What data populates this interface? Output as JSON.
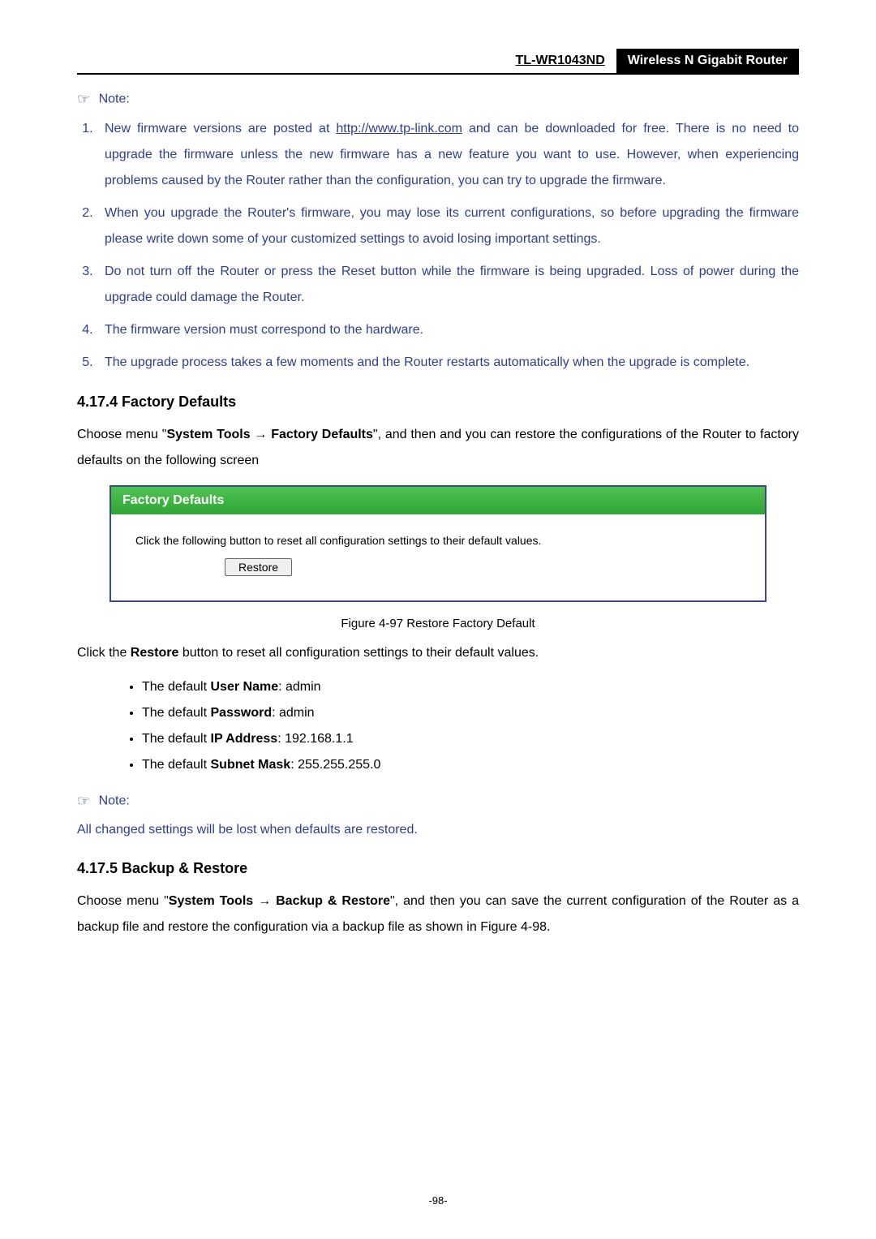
{
  "header": {
    "model": "TL-WR1043ND",
    "subtitle": "Wireless N Gigabit Router"
  },
  "note1": {
    "label": "Note:",
    "items": [
      {
        "pre": "New firmware versions are posted at ",
        "link": "http://www.tp-link.com",
        "post": " and can be downloaded for free. There is no need to upgrade the firmware unless the new firmware has a new feature you want to use. However, when experiencing problems caused by the Router rather than the configuration, you can try to upgrade the firmware."
      },
      {
        "text": "When you upgrade the Router's firmware, you may lose its current configurations, so before upgrading the firmware please write down some of your customized settings to avoid losing important settings."
      },
      {
        "text": "Do not turn off the Router or press the Reset button while the firmware is being upgraded. Loss of power during the upgrade could damage the Router."
      },
      {
        "text": "The firmware version must correspond to the hardware."
      },
      {
        "text": "The upgrade process takes a few moments and the Router restarts automatically when the upgrade is complete."
      }
    ]
  },
  "section1": {
    "title": "4.17.4  Factory Defaults",
    "intro_pre": "Choose menu \"",
    "intro_bold1": "System Tools",
    "intro_arrow": " → ",
    "intro_bold2": " Factory Defaults",
    "intro_post": "\", and then and you can restore the configurations of the Router to factory defaults on the following screen",
    "figure": {
      "header": "Factory Defaults",
      "desc": "Click the following button to reset all configuration settings to their default values.",
      "button": "Restore",
      "caption": "Figure 4-97 Restore Factory Default"
    },
    "post_figure_pre": "Click the ",
    "post_figure_bold": "Restore",
    "post_figure_post": " button to reset all configuration settings to their default values.",
    "bullets": [
      {
        "pre": "The default ",
        "bold": "User Name",
        "post": ": admin"
      },
      {
        "pre": "The default ",
        "bold": "Password",
        "post": ": admin"
      },
      {
        "pre": "The default ",
        "bold": "IP Address",
        "post": ": 192.168.1.1"
      },
      {
        "pre": "The default ",
        "bold": "Subnet Mask",
        "post": ": 255.255.255.0"
      }
    ]
  },
  "note2": {
    "label": "Note:",
    "text": "All changed settings will be lost when defaults are restored."
  },
  "section2": {
    "title": "4.17.5  Backup & Restore",
    "intro_pre": "Choose menu \"",
    "intro_bold1": "System Tools",
    "intro_arrow": " → ",
    "intro_bold2": "Backup & Restore",
    "intro_post": "\", and then you can save the current configuration of the Router as a backup file and restore the configuration via a backup file as shown in Figure 4-98."
  },
  "page_number": "-98-"
}
